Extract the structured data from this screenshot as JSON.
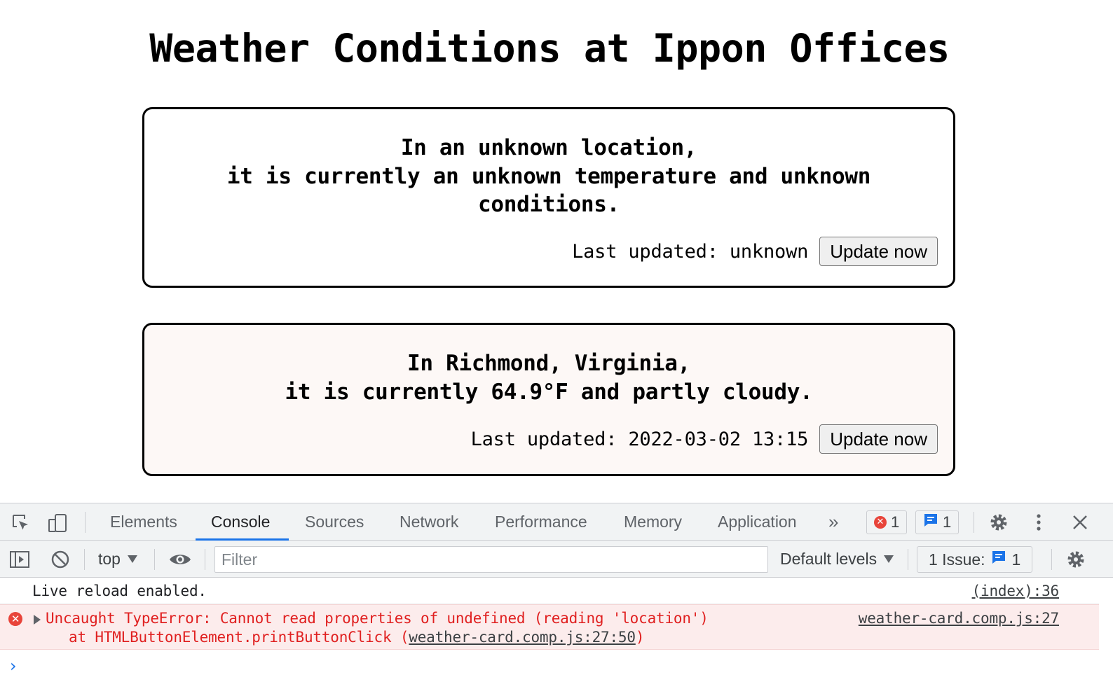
{
  "page": {
    "title": "Weather Conditions at Ippon Offices",
    "cards": [
      {
        "message_line1": "In an unknown location,",
        "message_line2": "it is currently an unknown temperature and unknown conditions.",
        "last_updated": "Last updated: unknown",
        "button": "Update now"
      },
      {
        "message_line1": "In Richmond, Virginia,",
        "message_line2": "it is currently 64.9°F and partly cloudy.",
        "last_updated": "Last updated: 2022-03-02 13:15",
        "button": "Update now"
      }
    ]
  },
  "devtools": {
    "tabs": [
      "Elements",
      "Console",
      "Sources",
      "Network",
      "Performance",
      "Memory",
      "Application"
    ],
    "active_tab": "Console",
    "more_tabs": "»",
    "error_count": "1",
    "message_count": "1",
    "toolbar": {
      "context": "top",
      "filter_placeholder": "Filter",
      "levels": "Default levels",
      "issues_label": "1 Issue:",
      "issues_count": "1"
    },
    "console": {
      "info_message": "Live reload enabled.",
      "info_source": "(index):36",
      "error_line1": "Uncaught TypeError: Cannot read properties of undefined (reading 'location')",
      "error_line2_prefix": "at HTMLButtonElement.printButtonClick (",
      "error_line2_link": "weather-card.comp.js:27:50",
      "error_line2_suffix": ")",
      "error_source": "weather-card.comp.js:27",
      "prompt": "›"
    },
    "colors": {
      "accent": "#1a73e8",
      "error": "#e02020",
      "error_bg": "#fcecec"
    }
  }
}
